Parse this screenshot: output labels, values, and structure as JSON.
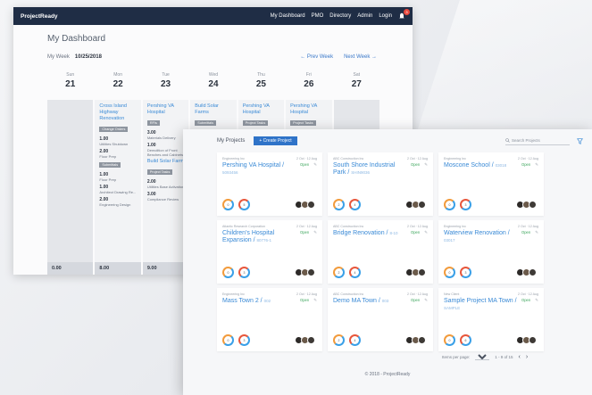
{
  "dashboard": {
    "brand": "ProjectReady",
    "nav": [
      "My Dashboard",
      "PMO",
      "Directory",
      "Admin",
      "Login"
    ],
    "notification_count": "3",
    "title": "My Dashboard",
    "week_label": "My Week",
    "week_date": "10/25/2018",
    "prev_week": "Prev Week",
    "next_week": "Next Week",
    "days": [
      {
        "name": "Sun",
        "num": "21"
      },
      {
        "name": "Mon",
        "num": "22",
        "title": "Cross Island Highway Renovation",
        "tags": [
          "Change Orders",
          "Submittals"
        ],
        "tasks": [
          {
            "h": "1.00",
            "t": "Utilities Shutdown"
          },
          {
            "h": "2.00",
            "t": "Floor Prep"
          },
          {
            "h": "1.00",
            "t": "Floor Prep"
          },
          {
            "h": "1.00",
            "t": "Architect Drawing Re..."
          },
          {
            "h": "2.00",
            "t": "Engineering Design"
          }
        ],
        "total": "8.00"
      },
      {
        "name": "Tue",
        "num": "23",
        "title": "Pershing VA Hospital",
        "tags": [
          "RFIs",
          "Project Tasks"
        ],
        "tasks": [
          {
            "h": "3.00",
            "t": "Materials Delivery"
          },
          {
            "h": "1.00",
            "t": "Demolition of Front Benches and Cabinets"
          },
          {
            "h": "2.00",
            "t": "Utilities Base Activation"
          },
          {
            "h": "3.00",
            "t": "Compliance Review"
          }
        ],
        "title2": "Build Solar Farm",
        "total": "9.00"
      },
      {
        "name": "Wed",
        "num": "24",
        "title": "Build Solar Farms",
        "tags": [
          "Submittals"
        ]
      },
      {
        "name": "Thu",
        "num": "25",
        "title": "Pershing VA Hospital",
        "tags": [
          "Project Tasks"
        ]
      },
      {
        "name": "Fri",
        "num": "26",
        "title": "Pershing VA Hospital",
        "tags": [
          "Project Tasks"
        ]
      },
      {
        "name": "Sat",
        "num": "27"
      }
    ],
    "sun_total": "0.00"
  },
  "projects": {
    "label": "My Projects",
    "create_button": "Create Project",
    "search_placeholder": "Search Projects",
    "cards": [
      {
        "org": "Engineering Inc",
        "meta": "2 Oct · 12 Aug",
        "status": "Open",
        "name": "Pershing VA Hospital /",
        "num": "5093456",
        "ring1": "0",
        "ring2": "5"
      },
      {
        "org": "ABC Construction Inc",
        "meta": "2 Oct · 12 Aug",
        "status": "Open",
        "name": "South Shore Industrial Park /",
        "num": "SHIN9036",
        "ring1": "2",
        "ring2": "4"
      },
      {
        "org": "Engineering Inc",
        "meta": "2 Oct · 12 Aug",
        "status": "Open",
        "name": "Moscone School /",
        "num": "03018",
        "ring1": "0",
        "ring2": "3"
      },
      {
        "org": "Atlantic Research Corporation",
        "meta": "2 Oct · 12 Aug",
        "status": "Open",
        "name": "Children's Hospital Expansion /",
        "num": "80776-1",
        "ring1": "0",
        "ring2": "3"
      },
      {
        "org": "ABC Construction Inc",
        "meta": "2 Oct · 12 Aug",
        "status": "Open",
        "name": "Bridge Renovation /",
        "num": "8-10",
        "ring1": "2",
        "ring2": "4"
      },
      {
        "org": "Engineering Inc",
        "meta": "2 Oct · 12 Aug",
        "status": "Open",
        "name": "Waterview Renovation /",
        "num": "03017",
        "ring1": "0",
        "ring2": "3"
      },
      {
        "org": "Engineering Inc",
        "meta": "2 Oct · 12 Aug",
        "status": "Open",
        "name": "Mass Town 2 /",
        "num": "002",
        "ring1": "0",
        "ring2": "3"
      },
      {
        "org": "ABC Construction Inc",
        "meta": "2 Oct · 12 Aug",
        "status": "Open",
        "name": "Demo MA Town /",
        "num": "003",
        "ring1": "2",
        "ring2": "4"
      },
      {
        "org": "New Client",
        "meta": "2 Oct · 12 Aug",
        "status": "Open",
        "name": "Sample Project MA Town /",
        "num": "SAMPLE",
        "ring1": "0",
        "ring2": "6"
      }
    ],
    "rows_per_page_label": "Items per page:",
    "rows_per_page": "9",
    "range": "1 - 9 of 15",
    "footer": "© 2018 - ProjectReady"
  }
}
